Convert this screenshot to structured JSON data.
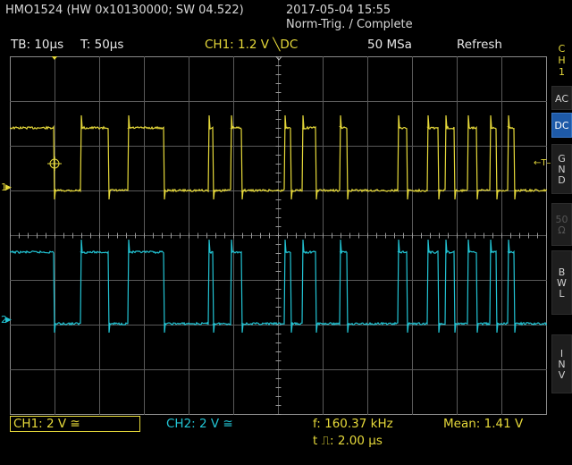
{
  "header": {
    "model": "HMO1524 (HW 0x10130000; SW 04.522)",
    "datetime": "2017-05-04 15:55",
    "trigger_status": "Norm-Trig. / Complete"
  },
  "status_bar": {
    "timebase": "TB: 10µs",
    "trigger_time": "T: 50µs",
    "ch1_trigger": "CH1: 1.2 V ╲DC",
    "sample_rate": "50 MSa",
    "acq_mode": "Refresh"
  },
  "side_menu": {
    "channel_label": [
      "C",
      "H",
      "1"
    ],
    "buttons": [
      {
        "label": [
          "AC"
        ],
        "selected": false,
        "enabled": true
      },
      {
        "label": [
          "DC"
        ],
        "selected": true,
        "enabled": true
      },
      {
        "label": [
          "G",
          "N",
          "D"
        ],
        "selected": false,
        "enabled": true
      },
      {
        "label": [
          "50",
          "Ω"
        ],
        "selected": false,
        "enabled": false
      },
      {
        "label": [
          "B",
          "W",
          "L"
        ],
        "selected": false,
        "enabled": true
      },
      {
        "label": [
          "I",
          "N",
          "V"
        ],
        "selected": false,
        "enabled": true
      }
    ]
  },
  "screen_markers": {
    "ch1_ground": "1",
    "ch2_ground": "2",
    "trigger_level": "←T–"
  },
  "footer": {
    "ch1_scale": "CH1: 2 V ≅",
    "ch2_scale": "CH2: 2 V ≅",
    "frequency": "f: 160.37 kHz",
    "pulse_width": "t ⎍: 2.00 µs",
    "mean": "Mean: 1.41 V"
  },
  "colors": {
    "ch1": "#e6d93a",
    "ch2": "#22c4d4",
    "grid": "#5a5a5a",
    "selected_button": "#1e5aa8"
  },
  "chart_data": {
    "type": "line",
    "grid": true,
    "divisions": {
      "x": 12,
      "y": 8
    },
    "x_unit": "µs",
    "x_per_div": 10,
    "series": [
      {
        "name": "CH1",
        "levels": {
          "low": 0,
          "high": 1
        },
        "high_intervals_div": [
          [
            0,
            1.0
          ],
          [
            1.6,
            2.2
          ],
          [
            2.65,
            3.45
          ],
          [
            4.45,
            4.55
          ],
          [
            4.95,
            5.2
          ],
          [
            6.15,
            6.3
          ],
          [
            6.55,
            6.85
          ],
          [
            7.4,
            7.55
          ],
          [
            8.7,
            8.9
          ],
          [
            9.35,
            9.6
          ],
          [
            9.75,
            9.95
          ],
          [
            10.25,
            10.45
          ],
          [
            10.75,
            10.9
          ],
          [
            11.15,
            11.3
          ]
        ]
      },
      {
        "name": "CH2",
        "levels": {
          "low": 0,
          "high": 1
        },
        "high_intervals_div": [
          [
            0,
            1.0
          ],
          [
            1.6,
            2.2
          ],
          [
            2.65,
            3.45
          ],
          [
            4.45,
            4.55
          ],
          [
            4.95,
            5.2
          ],
          [
            6.15,
            6.3
          ],
          [
            6.55,
            6.85
          ],
          [
            7.4,
            7.55
          ],
          [
            8.7,
            8.9
          ],
          [
            9.35,
            9.6
          ],
          [
            9.75,
            9.95
          ],
          [
            10.25,
            10.45
          ],
          [
            10.75,
            10.9
          ],
          [
            11.15,
            11.3
          ]
        ]
      }
    ]
  }
}
